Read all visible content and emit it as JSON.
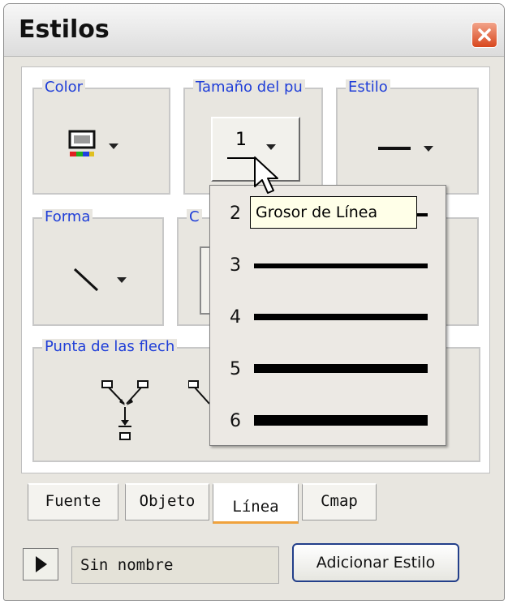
{
  "window": {
    "title": "Estilos"
  },
  "groups": {
    "color": "Color",
    "size": "Tamaño del pu",
    "style": "Estilo",
    "shape": "Forma",
    "c_partial": "C",
    "arrow": "Punta de las flech"
  },
  "size_button": {
    "value": "1"
  },
  "dropdown": {
    "items": [
      {
        "label": "2"
      },
      {
        "label": "3"
      },
      {
        "label": "4"
      },
      {
        "label": "5"
      },
      {
        "label": "6"
      }
    ]
  },
  "tooltip": "Grosor de Línea",
  "tabs": [
    "Fuente",
    "Objeto",
    "Línea",
    "Cmap"
  ],
  "active_tab": "Línea",
  "footer": {
    "style_name": "Sin nombre",
    "add_button": "Adicionar Estilo"
  },
  "colors": {
    "accent": "#1f3ed8",
    "tab_highlight": "#f0a23c",
    "close": "#d8471e"
  },
  "icons": [
    "close-icon",
    "color-swatch-icon",
    "line-style-icon",
    "line-shape-icon",
    "arrowhead-icon",
    "play-icon",
    "mouse-cursor-icon"
  ]
}
